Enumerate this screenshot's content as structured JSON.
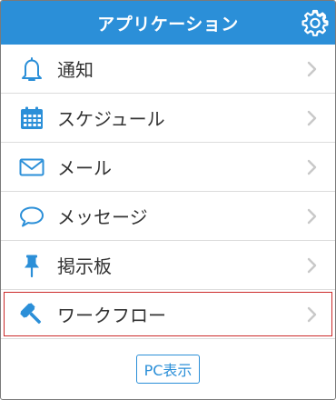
{
  "header": {
    "title": "アプリケーション",
    "settings_icon": "gear-icon"
  },
  "menu": {
    "items": [
      {
        "label": "通知",
        "icon": "bell-icon"
      },
      {
        "label": "スケジュール",
        "icon": "calendar-icon"
      },
      {
        "label": "メール",
        "icon": "envelope-icon"
      },
      {
        "label": "メッセージ",
        "icon": "speech-bubble-icon"
      },
      {
        "label": "掲示板",
        "icon": "pushpin-icon"
      },
      {
        "label": "ワークフロー",
        "icon": "gavel-icon",
        "highlighted": true
      }
    ]
  },
  "footer": {
    "pc_view_label": "PC表示"
  },
  "colors": {
    "accent": "#2b8fd8",
    "highlight_border": "#cc2a2a",
    "divider": "#dcdcdc",
    "chevron": "#c8c8c8"
  }
}
